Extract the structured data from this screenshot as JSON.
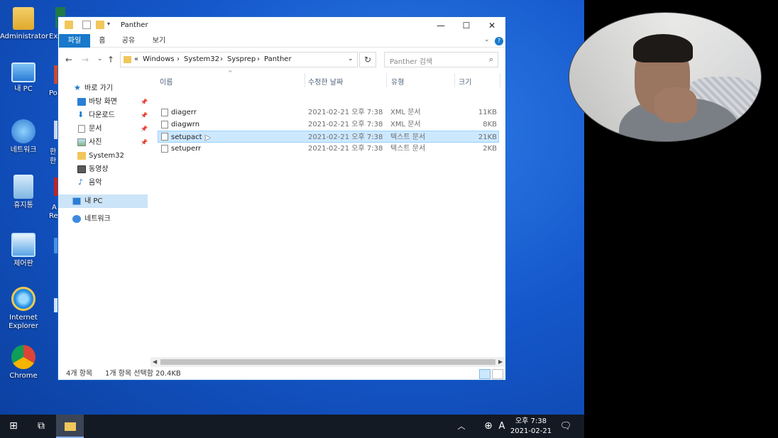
{
  "desktop": {
    "icons": [
      {
        "label": "Administrator",
        "icon": "user-folder-icon"
      },
      {
        "label": "내 PC",
        "icon": "computer-icon"
      },
      {
        "label": "네트워크",
        "icon": "network-icon"
      },
      {
        "label": "휴지통",
        "icon": "recycle-bin-icon"
      },
      {
        "label": "제어판",
        "icon": "control-panel-icon"
      },
      {
        "label": "Internet Explorer",
        "icon": "internet-explorer-icon"
      },
      {
        "label": "Chrome",
        "icon": "chrome-icon"
      }
    ],
    "partial_labels": [
      "Ex",
      "Po",
      "한",
      "한",
      "A",
      "Re"
    ]
  },
  "window": {
    "title": "Panther",
    "ribbon_tabs": [
      "파일",
      "홈",
      "공유",
      "보기"
    ],
    "breadcrumb": [
      "Windows",
      "System32",
      "Sysprep",
      "Panther"
    ],
    "breadcrumb_overflow": "«",
    "search_placeholder": "Panther 검색",
    "nav": [
      {
        "label": "바로 가기",
        "icon": "star-icon",
        "pinned": false
      },
      {
        "label": "바탕 화면",
        "icon": "desktop-icon",
        "pinned": true
      },
      {
        "label": "다운로드",
        "icon": "download-icon",
        "pinned": true
      },
      {
        "label": "문서",
        "icon": "documents-icon",
        "pinned": true
      },
      {
        "label": "사진",
        "icon": "pictures-icon",
        "pinned": true
      },
      {
        "label": "System32",
        "icon": "folder-icon",
        "pinned": false
      },
      {
        "label": "동영상",
        "icon": "videos-icon",
        "pinned": false
      },
      {
        "label": "음악",
        "icon": "music-icon",
        "pinned": false
      },
      {
        "label": "내 PC",
        "icon": "computer-icon",
        "pinned": false,
        "selected": true
      },
      {
        "label": "네트워크",
        "icon": "network-icon",
        "pinned": false
      }
    ],
    "columns": {
      "name": "이름",
      "modified": "수정한 날짜",
      "type": "유형",
      "size": "크기"
    },
    "files": [
      {
        "name": "diagerr",
        "modified": "2021-02-21 오후 7:38",
        "type": "XML 문서",
        "size": "11KB",
        "selected": false
      },
      {
        "name": "diagwrn",
        "modified": "2021-02-21 오후 7:38",
        "type": "XML 문서",
        "size": "8KB",
        "selected": false
      },
      {
        "name": "setupact",
        "modified": "2021-02-21 오후 7:38",
        "type": "텍스트 문서",
        "size": "21KB",
        "selected": true
      },
      {
        "name": "setuperr",
        "modified": "2021-02-21 오후 7:38",
        "type": "텍스트 문서",
        "size": "2KB",
        "selected": false
      }
    ],
    "status_count": "4개 항목",
    "status_selection": "1개 항목 선택함 20.4KB"
  },
  "taskbar": {
    "ime": "A",
    "time": "오후 7:38",
    "date": "2021-02-21"
  },
  "colors": {
    "accent": "#1979ca",
    "selection": "#cce8ff",
    "desktop": "#1558cc",
    "taskbar": "#141a24"
  }
}
